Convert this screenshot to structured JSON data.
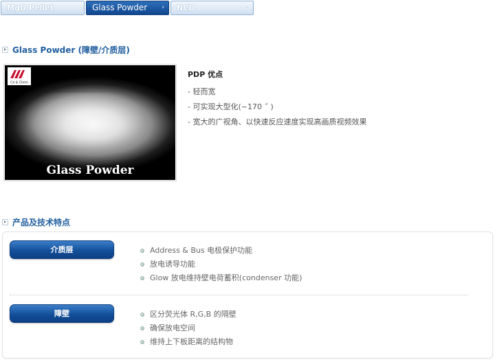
{
  "tabs": [
    {
      "label": "MgO Pellet",
      "active": false
    },
    {
      "label": "Glass Powder",
      "active": true,
      "chevron": "›"
    },
    {
      "label": "NCD",
      "active": false,
      "chevron": "›"
    }
  ],
  "section1": {
    "title": "Glass Powder (障壁/介质层)"
  },
  "photo": {
    "caption": "Glass Powder",
    "logo_text": "Ce & Chem",
    "alt": "Glass Powder"
  },
  "pdp": {
    "title": "PDP 优点",
    "items": [
      "- 轻而宽",
      "- 可实现大型化(~170 ˝ )",
      "- 宽大的广视角、以快速反应速度实现高画质视频效果"
    ]
  },
  "section2": {
    "title": "产品及技术特点"
  },
  "features": [
    {
      "label": "介质层",
      "items": [
        "Address & Bus 电极保护功能",
        "放电诱导功能",
        "Glow 放电维持壁电荷蓄积(condenser 功能)"
      ]
    },
    {
      "label": "障壁",
      "items": [
        "区分荧光体 R,G,B 的隔壁",
        "确保放电空间",
        "维持上下板距离的结构物"
      ]
    }
  ]
}
